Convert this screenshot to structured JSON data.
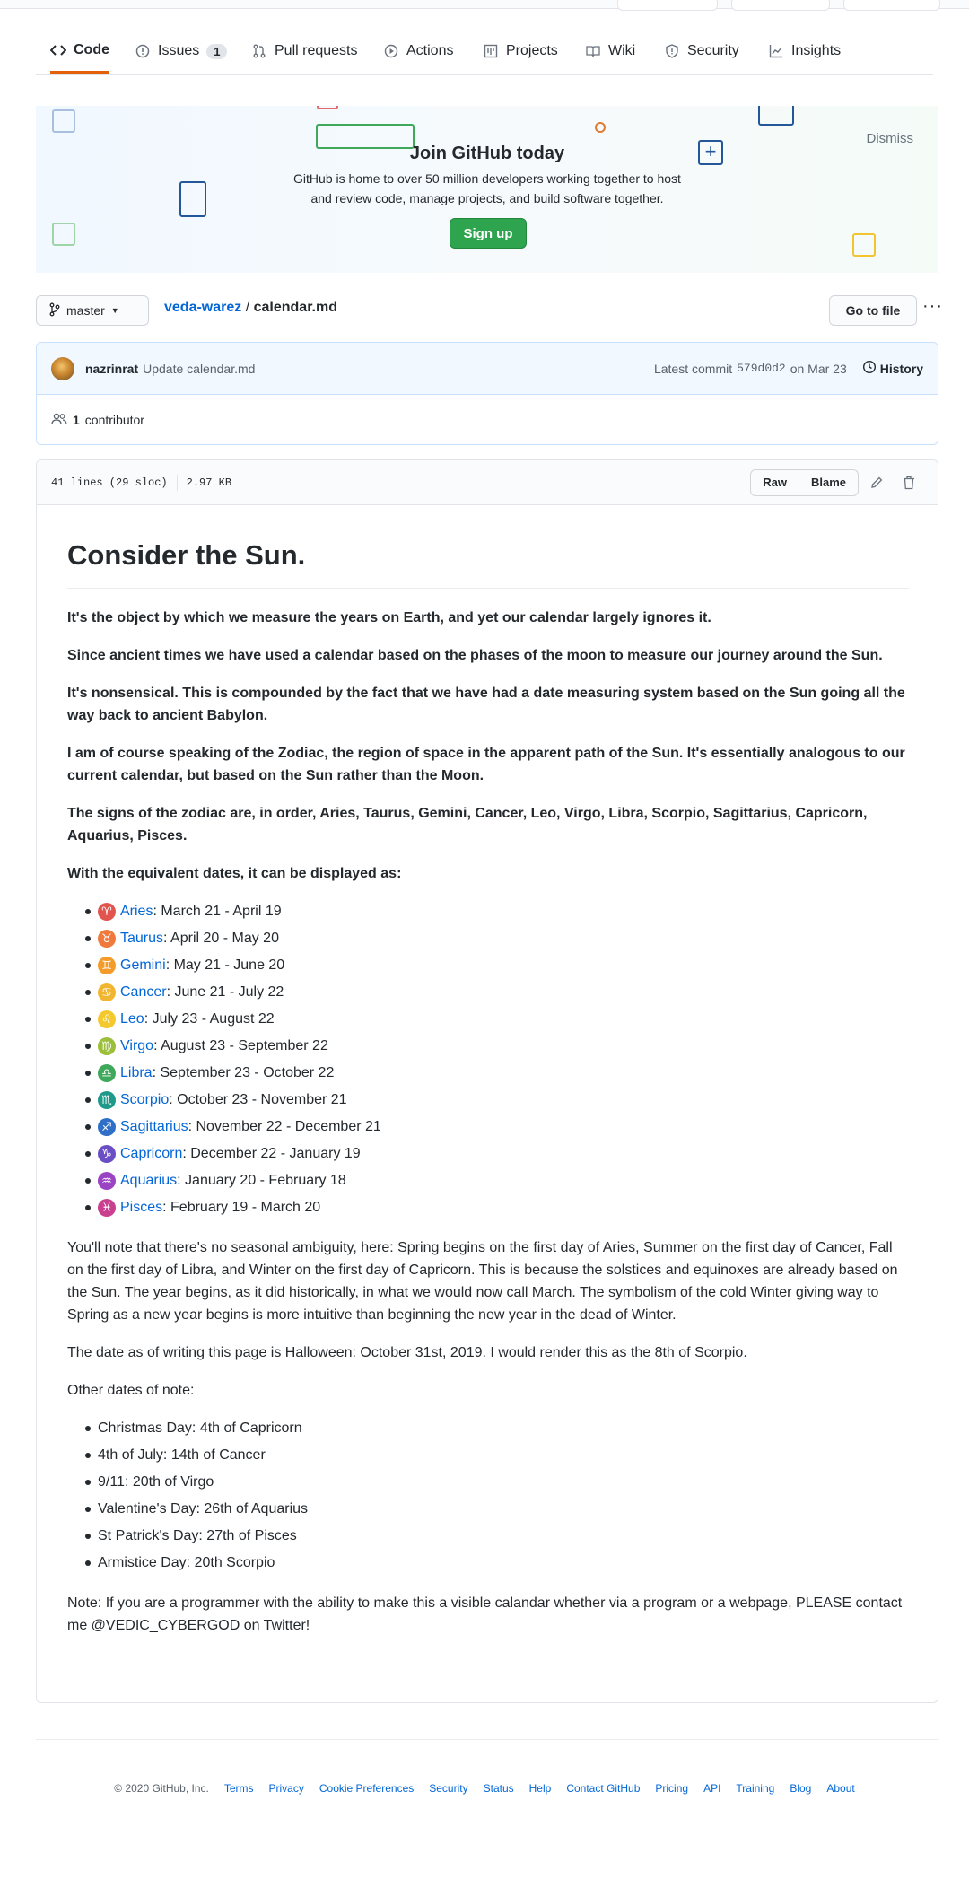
{
  "tabs": [
    {
      "label": "Code",
      "icon": "code-icon"
    },
    {
      "label": "Issues",
      "icon": "issue-icon",
      "count": "1"
    },
    {
      "label": "Pull requests",
      "icon": "pull-request-icon"
    },
    {
      "label": "Actions",
      "icon": "play-icon"
    },
    {
      "label": "Projects",
      "icon": "project-icon"
    },
    {
      "label": "Wiki",
      "icon": "book-icon"
    },
    {
      "label": "Security",
      "icon": "shield-icon"
    },
    {
      "label": "Insights",
      "icon": "graph-icon"
    }
  ],
  "banner": {
    "title": "Join GitHub today",
    "text1": "GitHub is home to over 50 million developers working together to host",
    "text2": "and review code, manage projects, and build software together.",
    "signup": "Sign up",
    "dismiss": "Dismiss"
  },
  "branch": {
    "name": "master"
  },
  "breadcrumb": {
    "repo": "veda-warez",
    "separator": " / ",
    "file": "calendar.md"
  },
  "goto_file": "Go to file",
  "more": "···",
  "commit": {
    "author": "nazrinrat",
    "message": "Update calendar.md",
    "latest_label": "Latest commit",
    "sha": "579d0d2",
    "date": "on Mar 23",
    "history": "History",
    "contributors_count": "1",
    "contributors_label": "contributor"
  },
  "file": {
    "lines": "41 lines (29 sloc)",
    "size": "2.97 KB",
    "raw": "Raw",
    "blame": "Blame"
  },
  "content": {
    "heading": "Consider the Sun.",
    "p1": "It's the object by which we measure the years on Earth, and yet our calendar largely ignores it.",
    "p2": "Since ancient times we have used a calendar based on the phases of the moon to measure our journey around the Sun.",
    "p3": "It's nonsensical. This is compounded by the fact that we have had a date measuring system based on the Sun going all the way back to ancient Babylon.",
    "p4": "I am of course speaking of the Zodiac, the region of space in the apparent path of the Sun. It's essentially analogous to our current calendar, but based on the Sun rather than the Moon.",
    "p5": "The signs of the zodiac are, in order, Aries, Taurus, Gemini, Cancer, Leo, Virgo, Libra, Scorpio, Sagittarius, Capricorn, Aquarius, Pisces.",
    "p6": "With the equivalent dates, it can be displayed as:",
    "signs": [
      {
        "symbol": "♈",
        "color": "#e0564f",
        "name": "Aries",
        "dates": ": March 21 - April 19"
      },
      {
        "symbol": "♉",
        "color": "#ef7a3c",
        "name": "Taurus",
        "dates": ": April 20 - May 20"
      },
      {
        "symbol": "♊",
        "color": "#f39c2a",
        "name": "Gemini",
        "dates": ": May 21 - June 20"
      },
      {
        "symbol": "♋",
        "color": "#f2b530",
        "name": "Cancer",
        "dates": ": June 21 - July 22"
      },
      {
        "symbol": "♌",
        "color": "#f4c92e",
        "name": "Leo",
        "dates": ": July 23 - August 22"
      },
      {
        "symbol": "♍",
        "color": "#9bbf3a",
        "name": "Virgo",
        "dates": ": August 23 - September 22"
      },
      {
        "symbol": "♎",
        "color": "#3fa85b",
        "name": "Libra",
        "dates": ": September 23 - October 22"
      },
      {
        "symbol": "♏",
        "color": "#1f9a8a",
        "name": "Scorpio",
        "dates": ": October 23 - November 21"
      },
      {
        "symbol": "♐",
        "color": "#2f6fc7",
        "name": "Sagittarius",
        "dates": ": November 22 - December 21"
      },
      {
        "symbol": "♑",
        "color": "#6a4fc4",
        "name": "Capricorn",
        "dates": ": December 22 - January 19"
      },
      {
        "symbol": "♒",
        "color": "#9a44c4",
        "name": "Aquarius",
        "dates": ": January 20 - February 18"
      },
      {
        "symbol": "♓",
        "color": "#c9408f",
        "name": "Pisces",
        "dates": ": February 19 - March 20"
      }
    ],
    "p7": "You'll note that there's no seasonal ambiguity, here: Spring begins on the first day of Aries, Summer on the first day of Cancer, Fall on the first day of Libra, and Winter on the first day of Capricorn. This is because the solstices and equinoxes are already based on the Sun. The year begins, as it did historically, in what we would now call March. The symbolism of the cold Winter giving way to Spring as a new year begins is more intuitive than beginning the new year in the dead of Winter.",
    "p8": "The date as of writing this page is Halloween: October 31st, 2019. I would render this as the 8th of Scorpio.",
    "p9": "Other dates of note:",
    "dates": [
      "Christmas Day: 4th of Capricorn",
      "4th of July: 14th of Cancer",
      "9/11: 20th of Virgo",
      "Valentine's Day: 26th of Aquarius",
      "St Patrick's Day: 27th of Pisces",
      "Armistice Day: 20th Scorpio"
    ],
    "p10": "Note: If you are a programmer with the ability to make this a visible calandar whether via a program or a webpage, PLEASE contact me @VEDIC_CYBERGOD on Twitter!"
  },
  "footer": {
    "copyright": "© 2020 GitHub, Inc.",
    "links": [
      "Terms",
      "Privacy",
      "Cookie Preferences",
      "Security",
      "Status",
      "Help",
      "Contact GitHub",
      "Pricing",
      "API",
      "Training",
      "Blog",
      "About"
    ]
  }
}
